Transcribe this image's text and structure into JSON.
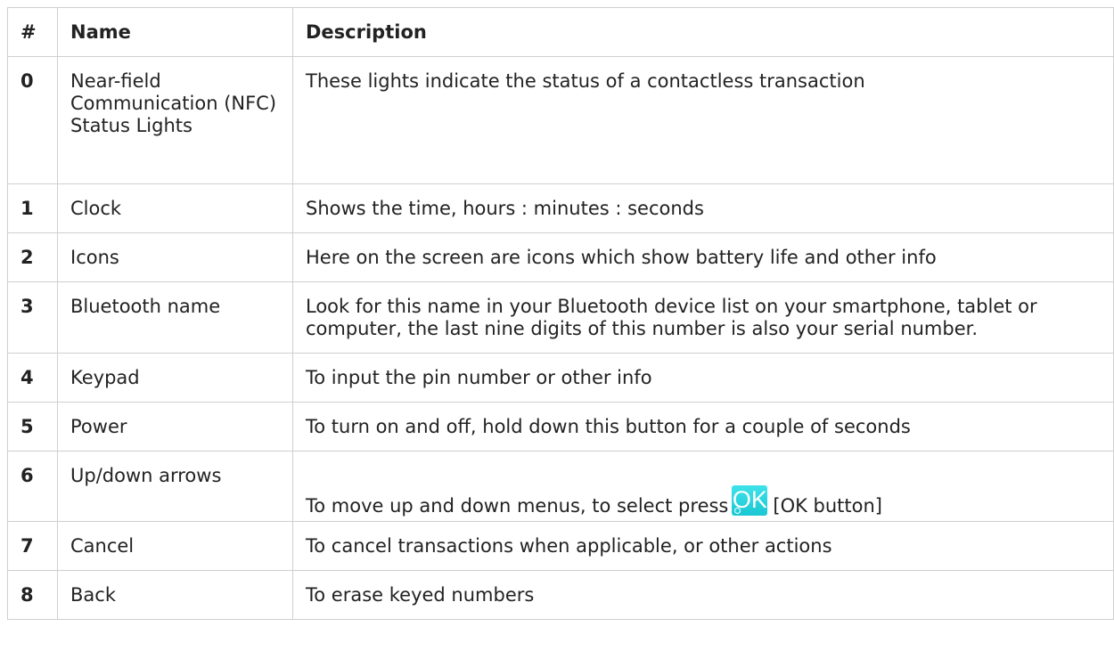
{
  "table": {
    "headers": {
      "num": "#",
      "name": "Name",
      "description": "Description"
    },
    "rows": [
      {
        "num": "0",
        "name": "Near-field Communication (NFC) Status Lights",
        "description": "These lights indicate the status of a contactless transaction"
      },
      {
        "num": "1",
        "name": "Clock",
        "description": "Shows the time, hours : minutes : seconds"
      },
      {
        "num": "2",
        "name": "Icons",
        "description": "Here on the screen are icons which show battery life and other info"
      },
      {
        "num": "3",
        "name": "Bluetooth name",
        "description": "Look for this name in your Bluetooth device list on your smartphone, tablet or computer, the last nine digits of this number is also your serial number."
      },
      {
        "num": "4",
        "name": "Keypad",
        "description": "To input the pin number or other info"
      },
      {
        "num": "5",
        "name": "Power",
        "description": "To turn on and off, hold down this button for a couple of seconds"
      },
      {
        "num": "6",
        "name": "Up/down arrows",
        "description_before": "To move up and down menus, to select press",
        "ok_icon_label": "OK",
        "description_after": "[OK button]"
      },
      {
        "num": "7",
        "name": "Cancel",
        "description": "To cancel transactions when applicable, or other actions"
      },
      {
        "num": "8",
        "name": "Back",
        "description": "To erase keyed numbers"
      }
    ]
  },
  "colors": {
    "ok_button": "#22d0da",
    "border": "#cfcfcf",
    "text": "#222222"
  },
  "icons": {
    "ok": "ok-button-icon"
  }
}
